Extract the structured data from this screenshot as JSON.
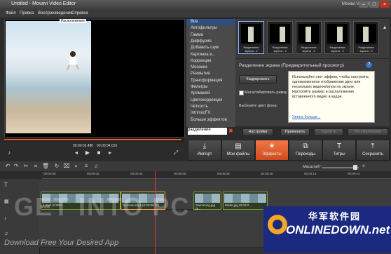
{
  "window": {
    "title": "Untitled - Movavi Video Editor",
    "brand": "Movavi Video Editor"
  },
  "menu": [
    "Файл",
    "Правка",
    "Воспроизведение",
    "Справка"
  ],
  "preview": {
    "label": "Расположение",
    "time_current": "00:00:03.480",
    "time_total": "00:00:04.010"
  },
  "effects_list": {
    "items": [
      "Все",
      "Автофильтры",
      "Гамма",
      "Диффузия",
      "Добавить шум",
      "Картинка в...",
      "Коррекция",
      "Мозаика",
      "Размытие",
      "Трансформация",
      "Фильтры",
      "Хромакей",
      "Цветокоррекция",
      "Четкость",
      "IntrinsicFX",
      "Больше эффектов"
    ],
    "search_value": "разделение"
  },
  "thumbs": [
    {
      "caption": "Разделение экрана - 2"
    },
    {
      "caption": "Разделение экрана - 3"
    },
    {
      "caption": "Разделение экрана - 3"
    },
    {
      "caption": "Разделение экрана - 2"
    },
    {
      "caption": "Разделение экрана - 2"
    }
  ],
  "panel": {
    "title": "Разделение экрана (Предварительный просмотр)",
    "crop_label": "Кадрировать",
    "scale_label": "Масштабировать рамку по",
    "bg_label": "Выберите цвет фона:",
    "tooltip": "Используйте этот эффект, чтобы настроить одновременное отображение двух или нескольких видеоклипов на экране. Настройте размер и расположение вставленного видео в кадре.",
    "tooltip_link": "Узнать больше...",
    "settings_label": "Настройки",
    "apply_label": "Применить",
    "delete_label": "Удалить",
    "favorites_label": "По умолчанию"
  },
  "tools": [
    {
      "label": "Импорт",
      "icon": "import-icon"
    },
    {
      "label": "Мои файлы",
      "icon": "folder-icon"
    },
    {
      "label": "Эффекты",
      "icon": "star-icon"
    },
    {
      "label": "Переходы",
      "icon": "transitions-icon"
    },
    {
      "label": "Титры",
      "icon": "titles-icon"
    },
    {
      "label": "Сохранить",
      "icon": "save-icon"
    }
  ],
  "timeline": {
    "zoom_label": "Масштаб:",
    "ticks": [
      "00:00:00",
      "00:00:02",
      "00:00:04",
      "00:00:06",
      "00:00:08",
      "00:00:10",
      "00:00:12",
      "00:00:14"
    ],
    "clips": [
      {
        "label": "1.mp4 (0:00:0...",
        "selected": false
      },
      {
        "label": "Summer.mp4 (0:00:06:00)",
        "selected": true
      },
      {
        "label": "Swimming.jpg (0...",
        "selected": false
      },
      {
        "label": "Water.jpg (0:00:0...",
        "selected": false
      }
    ]
  },
  "watermarks": {
    "getinto": "GET INTO PC",
    "download": "Download Free Your Desired App",
    "logo_cn": "华军软件园",
    "logo_en": "ONLINEDOWN.net"
  }
}
